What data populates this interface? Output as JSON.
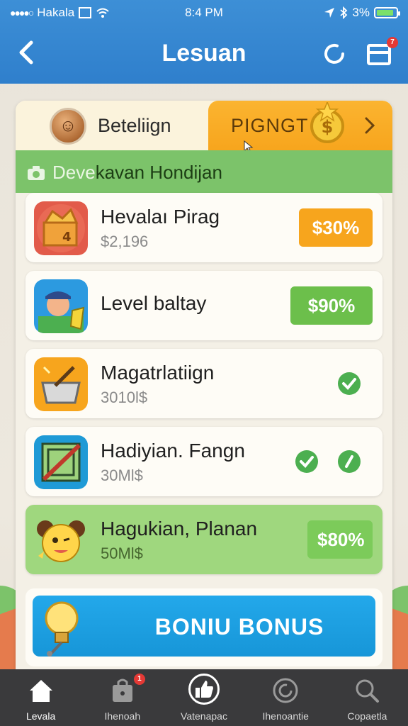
{
  "status_bar": {
    "carrier": "Hakala",
    "time": "8:4 PM",
    "battery": "3%",
    "battery_level": 0.9
  },
  "header": {
    "title": "Lesuan",
    "refresh_badge": "",
    "card_badge": "7"
  },
  "panel": {
    "username": "Beteliign",
    "promo_label": "PIGNGT",
    "section_title_prefix": "Deve",
    "section_title": "kavan Hondijan"
  },
  "rows": [
    {
      "title": "Hevalaı Pirag",
      "subtitle": "$2,196",
      "badge": "$30%",
      "badge_style": "orange",
      "icon": "treasure-chest-icon"
    },
    {
      "title": "Level baltay",
      "subtitle": "",
      "badge": "$90%",
      "badge_style": "green",
      "icon": "character-avatar-icon"
    },
    {
      "title": "Magatrlatiign",
      "subtitle": "3010l$",
      "badge": "",
      "checks": 1,
      "icon": "basket-icon"
    },
    {
      "title": "Hadiyian. Fangn",
      "subtitle": "30Ml$",
      "badge": "",
      "checks": 2,
      "icon": "crossed-box-icon"
    },
    {
      "title": "Hagukian, Planan",
      "subtitle": "50Ml$",
      "badge": "$80%",
      "badge_style": "lightgreen",
      "icon": "mascot-icon"
    }
  ],
  "bonus_button": {
    "label": "BONIU BONUS"
  },
  "tabbar": [
    {
      "label": "Levala",
      "icon": "home-icon",
      "badge": ""
    },
    {
      "label": "Ihenoah",
      "icon": "shop-icon",
      "badge": "1"
    },
    {
      "label": "Vatenapac",
      "icon": "thumb-icon",
      "badge": ""
    },
    {
      "label": "Ihenoantie",
      "icon": "refresh-icon",
      "badge": ""
    },
    {
      "label": "Copaetla",
      "icon": "search-icon",
      "badge": ""
    }
  ],
  "colors": {
    "header_blue": "#2f7fcc",
    "promo_orange": "#f7a51d",
    "section_green": "#7cc36a",
    "bonus_blue": "#1796d8",
    "tabbar_dark": "#3a3a3c"
  }
}
